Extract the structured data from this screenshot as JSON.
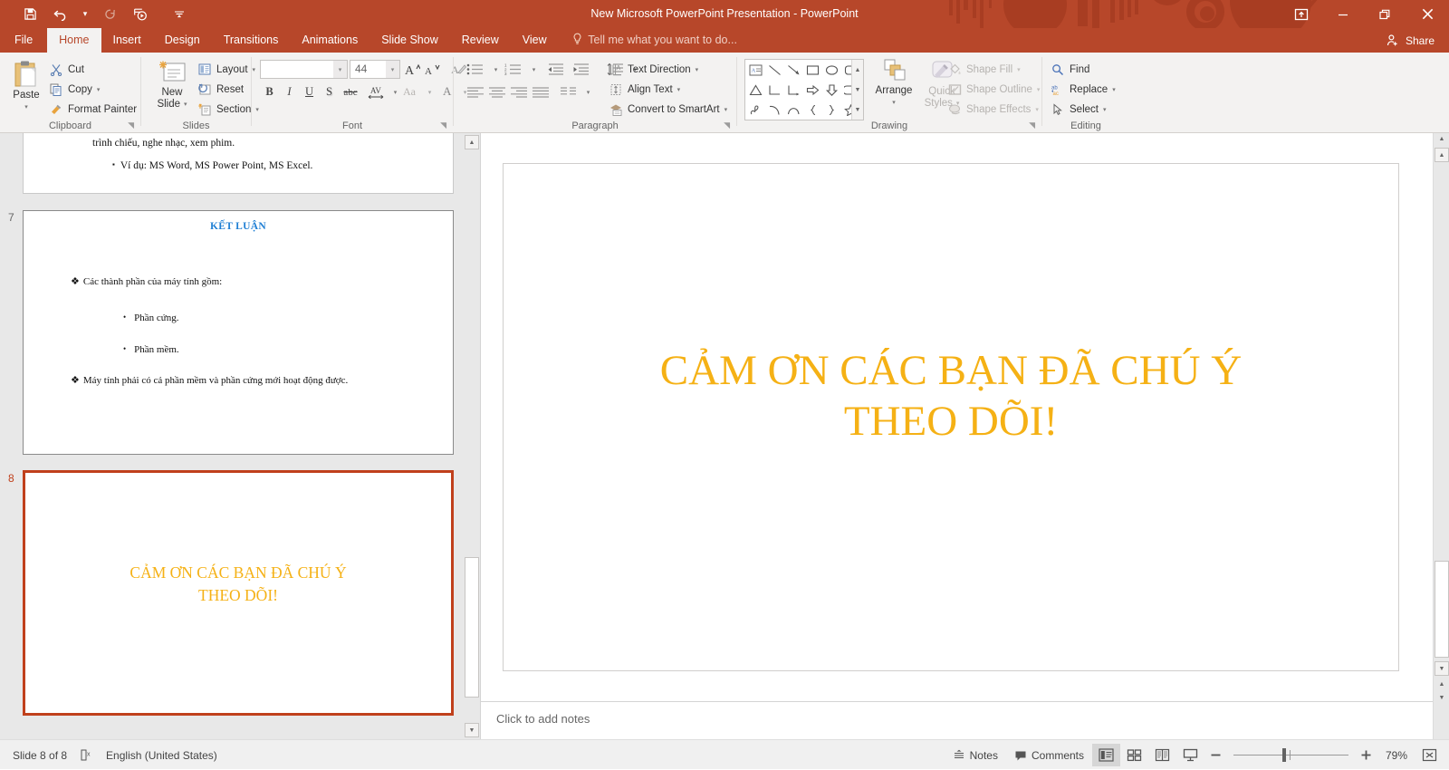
{
  "titlebar": {
    "title": "New Microsoft PowerPoint Presentation - PowerPoint",
    "quick_access": [
      {
        "name": "save",
        "glyph": "💾"
      },
      {
        "name": "undo",
        "glyph": "↶"
      },
      {
        "name": "redo",
        "glyph": "↻"
      },
      {
        "name": "start-from-beginning",
        "glyph": "▷"
      },
      {
        "name": "customize-quick-access-toolbar",
        "glyph": "☰"
      }
    ],
    "window_buttons": {
      "ribbon_display_options": "⬆",
      "minimize": "—",
      "restore": "❐",
      "close": "✕"
    }
  },
  "tabs": {
    "items": [
      {
        "label": "File",
        "active": false
      },
      {
        "label": "Home",
        "active": true
      },
      {
        "label": "Insert",
        "active": false
      },
      {
        "label": "Design",
        "active": false
      },
      {
        "label": "Transitions",
        "active": false
      },
      {
        "label": "Animations",
        "active": false
      },
      {
        "label": "Slide Show",
        "active": false
      },
      {
        "label": "Review",
        "active": false
      },
      {
        "label": "View",
        "active": false
      }
    ],
    "tell_me": "Tell me what you want to do...",
    "share": "Share"
  },
  "ribbon": {
    "clipboard": {
      "label": "Clipboard",
      "paste": "Paste",
      "cut": "Cut",
      "copy": "Copy",
      "format_painter": "Format Painter"
    },
    "slides": {
      "label": "Slides",
      "new_slide_line1": "New",
      "new_slide_line2": "Slide",
      "layout": "Layout",
      "reset": "Reset",
      "section": "Section"
    },
    "font": {
      "label": "Font",
      "font_name_value": "",
      "font_size_value": "44",
      "bold": "B",
      "italic": "I",
      "underline": "U",
      "shadow": "S",
      "strikethrough": "abc",
      "character_spacing": "AV",
      "change_case": "Aa",
      "font_color": "A",
      "increase_font_size": "A",
      "decrease_font_size": "A"
    },
    "paragraph": {
      "label": "Paragraph",
      "text_direction": "Text Direction",
      "align_text": "Align Text",
      "convert_to_smartart": "Convert to SmartArt"
    },
    "drawing": {
      "label": "Drawing",
      "arrange": "Arrange",
      "quick_styles_line1": "Quick",
      "quick_styles_line2": "Styles",
      "shape_fill": "Shape Fill",
      "shape_outline": "Shape Outline",
      "shape_effects": "Shape Effects"
    },
    "editing": {
      "label": "Editing",
      "find": "Find",
      "replace": "Replace",
      "select": "Select"
    }
  },
  "thumbnails": [
    {
      "number": "",
      "partial": true,
      "selected": false,
      "lines": [
        "trình chiếu, nghe nhạc, xem phim.",
        "Ví dụ: MS Word, MS Power Point, MS Excel."
      ]
    },
    {
      "number": "7",
      "partial": false,
      "selected": false,
      "title": "KẾT LUẬN",
      "bullets": [
        "Các thành phần của máy tính gồm:",
        "Phần cứng.",
        "Phần mềm.",
        "Máy tính phải có cả phần mềm và phần cứng mới hoạt động được."
      ]
    },
    {
      "number": "8",
      "partial": false,
      "selected": true,
      "title_line1": "CẢM ƠN CÁC BẠN ĐÃ CHÚ Ý",
      "title_line2": "THEO DÕI!"
    }
  ],
  "slide": {
    "title_line1": "CẢM ƠN CÁC BẠN ĐÃ CHÚ Ý",
    "title_line2": "THEO DÕI!",
    "title_color": "#f5b115"
  },
  "notes": {
    "placeholder": "Click to add notes"
  },
  "statusbar": {
    "slide_counter": "Slide 8 of 8",
    "language": "English (United States)",
    "notes_button": "Notes",
    "comments_button": "Comments",
    "zoom_percent": "79%",
    "views": [
      {
        "name": "normal-view",
        "active": true
      },
      {
        "name": "slide-sorter-view",
        "active": false
      },
      {
        "name": "reading-view",
        "active": false
      },
      {
        "name": "slide-show-view",
        "active": false
      }
    ]
  },
  "colors": {
    "accent": "#b7472a",
    "selection": "#c0401c",
    "slide_title": "#f5b115",
    "thumb_title_blue": "#1f7fd4"
  }
}
